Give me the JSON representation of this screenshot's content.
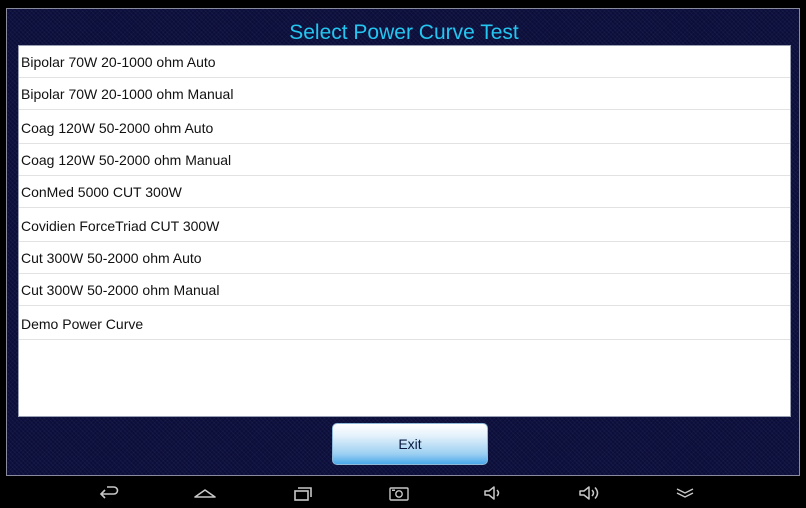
{
  "app": {
    "title": "Select Power Curve Test"
  },
  "list": {
    "items": [
      {
        "label": "Bipolar 70W 20-1000 ohm Auto"
      },
      {
        "label": "Bipolar 70W 20-1000 ohm Manual"
      },
      {
        "label": "Coag 120W 50-2000 ohm Auto"
      },
      {
        "label": "Coag 120W 50-2000 ohm Manual"
      },
      {
        "label": "ConMed 5000 CUT 300W"
      },
      {
        "label": "Covidien ForceTriad CUT 300W"
      },
      {
        "label": "Cut 300W 50-2000 ohm Auto"
      },
      {
        "label": "Cut 300W 50-2000 ohm Manual"
      },
      {
        "label": "Demo Power Curve"
      }
    ]
  },
  "footer": {
    "exit_label": "Exit"
  },
  "navbar": {
    "icons": [
      "back-icon",
      "home-icon",
      "recent-apps-icon",
      "screenshot-icon",
      "volume-down-icon",
      "volume-up-icon",
      "hide-navbar-icon"
    ]
  },
  "colors": {
    "title": "#22c6f0",
    "background": "#0b0e3a",
    "button_accent": "#4aa8ea"
  }
}
